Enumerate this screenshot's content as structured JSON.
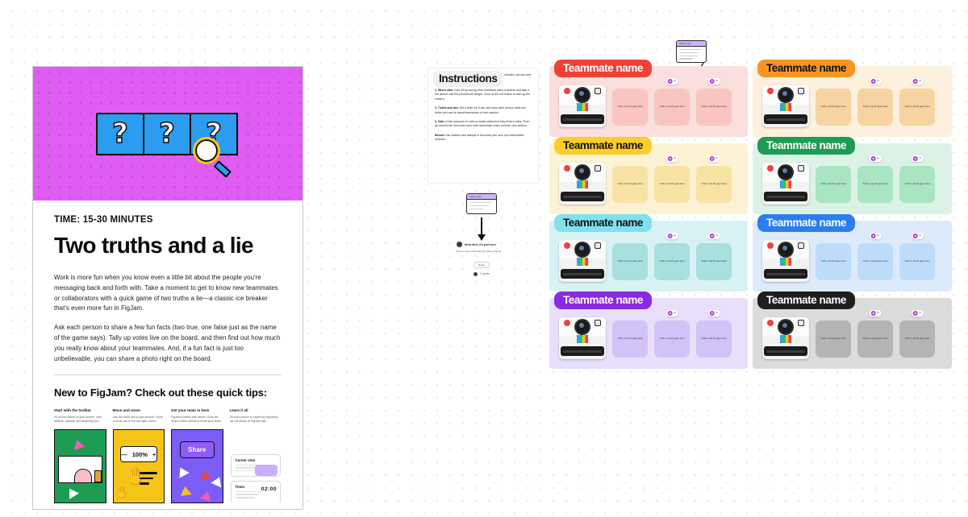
{
  "board": {
    "background_color": "#ffffff",
    "dot_grid_color": "#e3e3e6"
  },
  "template_card": {
    "time_label": "TIME: 15-30 MINUTES",
    "title": "Two truths and a lie",
    "hero": {
      "background_color": "#e15cf5",
      "card_color": "#2b9cf0",
      "question_mark": "?",
      "cards_count": 3,
      "magnifier_color": "#f5c518"
    },
    "paragraphs": [
      "Work is more fun when you know even a little bit about the people you're messaging back and forth with. Take a moment to get to know new teammates or collaborators with a quick game of two truths a lie—a classic ice breaker that's even more fun in FigJam.",
      "Ask each person to share a few fun facts (two true, one false just as the name of the game says). Tally up votes live on the board, and then find out how much you really know about your teammates. And, if a fun fact is just too unbelievable, you can share a photo right on the board."
    ],
    "tips_heading": "New to FigJam? Check out these quick tips:",
    "tips": [
      {
        "heading": "Start with the toolbar",
        "description": "It's at the bottom of your screen, with stickies, stamps, and anything you need.",
        "accent": "#1f9c54"
      },
      {
        "heading": "Move and zoom",
        "description": "Use the hand tool to pan around. Zoom controls are in the top right corner.",
        "accent": "#f5c518",
        "zoom_level": "100%",
        "zoom_minus": "—",
        "zoom_plus": "+"
      },
      {
        "heading": "Get your team in here",
        "description": "FigJam's better with others. Click the Share button above to invite your team.",
        "accent": "#7b5cf5",
        "share_label": "Share"
      },
      {
        "heading": "Learn it all",
        "description": "Go from novice to expert by exploring our full library of FigJam tips.",
        "accent": "#ffffff",
        "panels": [
          {
            "title": "Cursor chat",
            "bubble_color": "#c9aefc"
          },
          {
            "title": "Timer",
            "value": "02:00"
          }
        ]
      }
    ]
  },
  "instructions": {
    "label": "Instructions",
    "intro": "...minutes, old and new.",
    "steps": [
      {
        "bold": "1. Who's who:",
        "text": " Kick off by having each individual claim a section and take a fun picture with the photobooth widget. Click on the red button to start up the camera."
      },
      {
        "bold": "2. Truths and lies:",
        "text": " Set a timer for 5 min and have each person write two truths and one lie about themselves in their section."
      },
      {
        "bold": "3. Vote:",
        "text": " Invite everyone to vote on which statement they think is false. Then go around the room and have each teammate share out their own section."
      },
      {
        "bold": "Bonus!",
        "text": " Use stickers and stamps to decorate your and your teammates' sections."
      }
    ]
  },
  "widgets": {
    "top_note": {
      "header_color": "#cdb4fa",
      "header_text": "Sticky note",
      "lines": 4
    },
    "middle_note": {
      "header_color": "#cdb4fa",
      "header_text": "Sticky note",
      "lines": 3
    },
    "comment": {
      "author": "Hello there, it's your turn!",
      "body": "Drop a vote on the fact you think is the lie.",
      "pill": "Reply",
      "footer": "2 replies"
    }
  },
  "teammate_sections": [
    {
      "name": "Teammate name",
      "section_bg": "#fadfdc",
      "label_bg": "#ef4136",
      "label_color": "#ffffff",
      "sticky_bg": "#f9c5c0",
      "stickies": [
        {
          "text": "Truth or lie #1 goes here",
          "votes": null
        },
        {
          "text": "Truth or lie #2 goes here",
          "votes": "0"
        },
        {
          "text": "Truth or lie #3 goes here",
          "votes": "0"
        }
      ]
    },
    {
      "name": "Teammate name",
      "section_bg": "#fdf0dc",
      "label_bg": "#f79520",
      "label_color": "#111111",
      "sticky_bg": "#f6d3a0",
      "stickies": [
        {
          "text": "Truth or lie #1 goes here",
          "votes": null
        },
        {
          "text": "Truth or lie #2 goes here",
          "votes": "0"
        },
        {
          "text": "Truth or lie #3 goes here",
          "votes": "0"
        }
      ]
    },
    {
      "name": "Teammate name",
      "section_bg": "#fdf3d4",
      "label_bg": "#fccd2a",
      "label_color": "#111111",
      "sticky_bg": "#f8e2a4",
      "stickies": [
        {
          "text": "Truth or lie #1 goes here",
          "votes": null
        },
        {
          "text": "Truth or lie #2 goes here",
          "votes": "0"
        },
        {
          "text": "Truth or lie #3 goes here",
          "votes": "0"
        }
      ]
    },
    {
      "name": "Teammate name",
      "section_bg": "#ddf2e6",
      "label_bg": "#1f9c54",
      "label_color": "#ffffff",
      "sticky_bg": "#a9e5c2",
      "stickies": [
        {
          "text": "Truth or lie #1 goes here",
          "votes": null
        },
        {
          "text": "Truth or lie #2 goes here",
          "votes": "0"
        },
        {
          "text": "Truth or lie #3 goes here",
          "votes": "0"
        }
      ]
    },
    {
      "name": "Teammate name",
      "section_bg": "#d8f2f4",
      "label_bg": "#7fe0ee",
      "label_color": "#111111",
      "sticky_bg": "#a8dfdf",
      "stickies": [
        {
          "text": "Truth or lie #1 goes here",
          "votes": null
        },
        {
          "text": "Truth or lie #2 goes here",
          "votes": "0"
        },
        {
          "text": "Truth or lie #3 goes here",
          "votes": "0"
        }
      ]
    },
    {
      "name": "Teammate name",
      "section_bg": "#dceafb",
      "label_bg": "#2b7ef0",
      "label_color": "#ffffff",
      "sticky_bg": "#bcdcfa",
      "stickies": [
        {
          "text": "Truth or lie #1 goes here",
          "votes": null
        },
        {
          "text": "Truth or lie #2 goes here",
          "votes": "0"
        },
        {
          "text": "Truth or lie #3 goes here",
          "votes": "0"
        }
      ]
    },
    {
      "name": "Teammate name",
      "section_bg": "#e7dffb",
      "label_bg": "#8a2be2",
      "label_color": "#ffffff",
      "sticky_bg": "#d3c2f7",
      "stickies": [
        {
          "text": "Truth or lie #1 goes here",
          "votes": null
        },
        {
          "text": "Truth or lie #2 goes here",
          "votes": "0"
        },
        {
          "text": "Truth or lie #3 goes here",
          "votes": "0"
        }
      ]
    },
    {
      "name": "Teammate name",
      "section_bg": "#dcdcdc",
      "label_bg": "#1e1e1e",
      "label_color": "#ffffff",
      "sticky_bg": "#b4b4b4",
      "stickies": [
        {
          "text": "Truth or lie #1 goes here",
          "votes": null
        },
        {
          "text": "Truth or lie #2 goes here",
          "votes": "0"
        },
        {
          "text": "Truth or lie #3 goes here",
          "votes": "0"
        }
      ]
    }
  ]
}
